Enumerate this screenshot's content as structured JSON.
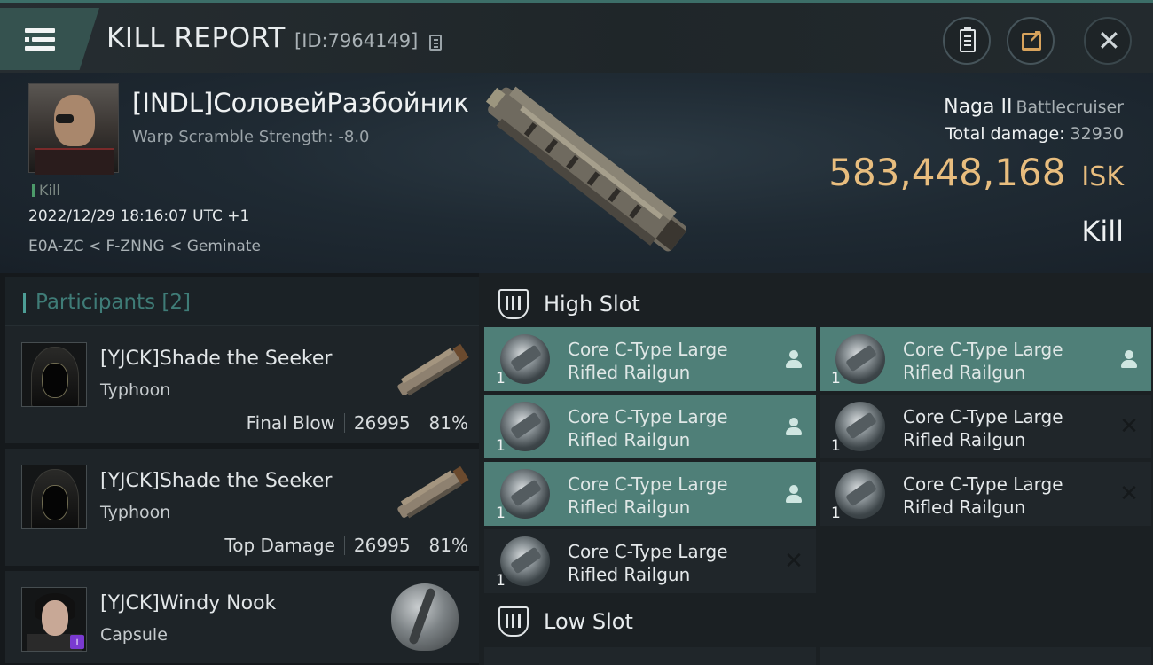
{
  "header": {
    "title": "KILL REPORT",
    "report_id": "[ID:7964149]"
  },
  "victim": {
    "name": "[INDL]СоловейРазбойник",
    "warp_scramble": "Warp Scramble Strength: -8.0",
    "tag": "Kill",
    "time": "2022/12/29 18:16:07 UTC +1",
    "location": "E0A-ZC < F-ZNNG < Geminate",
    "ship_name": "Naga II",
    "ship_class": "Battlecruiser",
    "total_damage_label": "Total damage:",
    "total_damage": "32930",
    "isk_value": "583,448,168",
    "isk_unit": "ISK",
    "outcome": "Kill"
  },
  "participants": {
    "title": "Participants [2]",
    "items": [
      {
        "name": "[YJCK]Shade the Seeker",
        "ship": "Typhoon",
        "role": "Final Blow",
        "damage": "26995",
        "percent": "81%"
      },
      {
        "name": "[YJCK]Shade the Seeker",
        "ship": "Typhoon",
        "role": "Top Damage",
        "damage": "26995",
        "percent": "81%"
      },
      {
        "name": "[YJCK]Windy Nook",
        "ship": "Capsule"
      }
    ]
  },
  "slots": {
    "high": {
      "title": "High Slot",
      "modules": [
        {
          "qty": "1",
          "line1": "Core C-Type Large",
          "line2": "Rifled Railgun",
          "status": "dropped"
        },
        {
          "qty": "1",
          "line1": "Core C-Type Large",
          "line2": "Rifled Railgun",
          "status": "dropped"
        },
        {
          "qty": "1",
          "line1": "Core C-Type Large",
          "line2": "Rifled Railgun",
          "status": "dropped"
        },
        {
          "qty": "1",
          "line1": "Core C-Type Large",
          "line2": "Rifled Railgun",
          "status": "destroyed"
        },
        {
          "qty": "1",
          "line1": "Core C-Type Large",
          "line2": "Rifled Railgun",
          "status": "dropped"
        },
        {
          "qty": "1",
          "line1": "Core C-Type Large",
          "line2": "Rifled Railgun",
          "status": "destroyed"
        },
        {
          "qty": "1",
          "line1": "Core C-Type Large",
          "line2": "Rifled Railgun",
          "status": "destroyed"
        }
      ]
    },
    "low": {
      "title": "Low Slot"
    }
  },
  "icons": {
    "menu": "hamburger-icon",
    "copy": "copy-icon",
    "clipboard": "clipboard-icon",
    "share": "share-icon",
    "close": "close-icon",
    "dropped": "person-icon",
    "destroyed": "cross-icon",
    "slot": "slot-icon"
  },
  "colors": {
    "accent_teal": "#4f7f78",
    "isk_gold": "#e8bd7e",
    "share_orange": "#d8a35c"
  }
}
